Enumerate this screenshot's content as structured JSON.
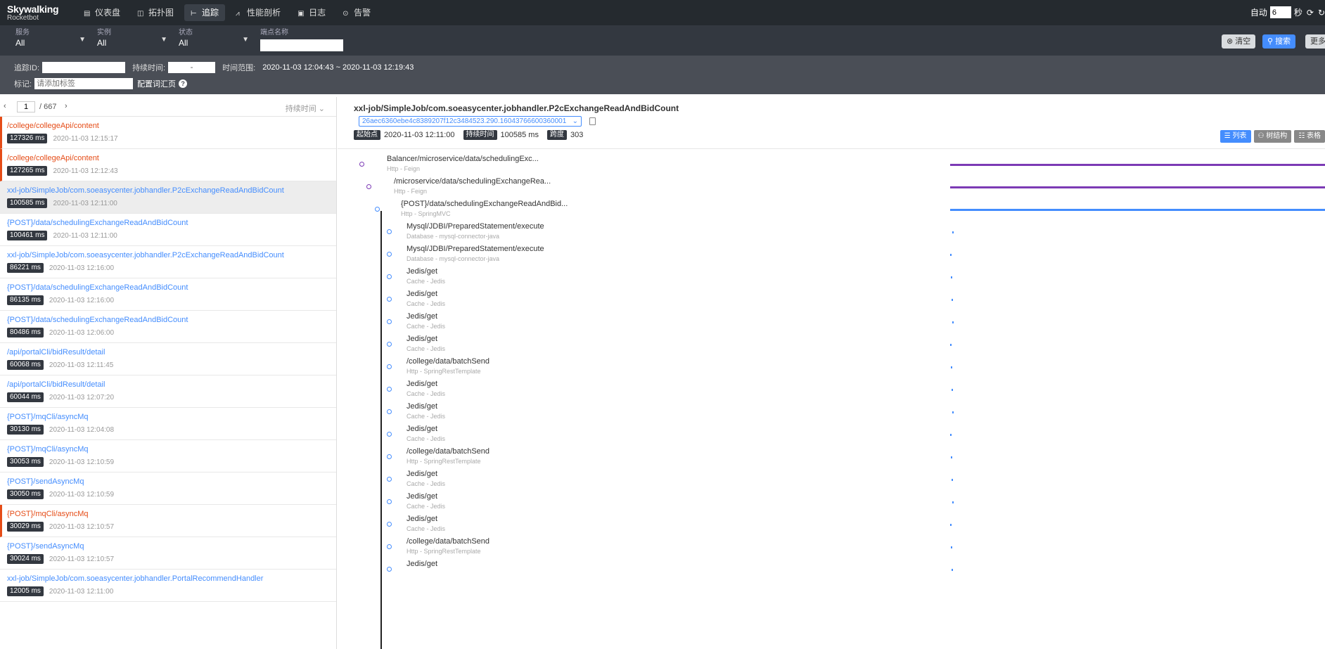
{
  "app": {
    "logo_line1": "Skywalking",
    "logo_line2": "Rocketbot"
  },
  "nav": [
    {
      "label": "仪表盘",
      "icon": "dashboard-icon",
      "glyph": "▤"
    },
    {
      "label": "拓扑图",
      "icon": "topology-icon",
      "glyph": "◫"
    },
    {
      "label": "追踪",
      "icon": "trace-icon",
      "glyph": "⊢"
    },
    {
      "label": "性能剖析",
      "icon": "profile-icon",
      "glyph": "⩘"
    },
    {
      "label": "日志",
      "icon": "log-icon",
      "glyph": "▣"
    },
    {
      "label": "告警",
      "icon": "alarm-icon",
      "glyph": "⊙"
    }
  ],
  "topright": {
    "auto_label": "自动",
    "interval": "6",
    "unit": "秒"
  },
  "filters": {
    "service": {
      "label": "服务",
      "value": "All"
    },
    "instance": {
      "label": "实例",
      "value": "All"
    },
    "status": {
      "label": "状态",
      "value": "All"
    },
    "endpoint": {
      "label": "端点名称",
      "value": ""
    },
    "clear": "清空",
    "search": "搜索",
    "more": "更多"
  },
  "filters2": {
    "trace_id_label": "追踪ID:",
    "duration_label": "持续时间:",
    "duration_sep": "-",
    "time_range_label": "时间范围:",
    "time_range_value": "2020-11-03 12:04:43 ~ 2020-11-03 12:19:43",
    "tag_label": "标记:",
    "tag_placeholder": "请添加标签",
    "config_link": "配置词汇页"
  },
  "pager": {
    "prev": "‹",
    "current": "1",
    "total": "/ 667",
    "next": "›",
    "sort": "持续时间"
  },
  "traces": [
    {
      "name": "/college/collegeApi/content",
      "duration": "127326 ms",
      "time": "2020-11-03 12:15:17",
      "error": true,
      "selected": false
    },
    {
      "name": "/college/collegeApi/content",
      "duration": "127265 ms",
      "time": "2020-11-03 12:12:43",
      "error": true,
      "selected": false
    },
    {
      "name": "xxl-job/SimpleJob/com.soeasycenter.jobhandler.P2cExchangeReadAndBidCount",
      "duration": "100585 ms",
      "time": "2020-11-03 12:11:00",
      "error": false,
      "selected": true
    },
    {
      "name": "{POST}/data/schedulingExchangeReadAndBidCount",
      "duration": "100461 ms",
      "time": "2020-11-03 12:11:00",
      "error": false,
      "selected": false
    },
    {
      "name": "xxl-job/SimpleJob/com.soeasycenter.jobhandler.P2cExchangeReadAndBidCount",
      "duration": "86221 ms",
      "time": "2020-11-03 12:16:00",
      "error": false,
      "selected": false
    },
    {
      "name": "{POST}/data/schedulingExchangeReadAndBidCount",
      "duration": "86135 ms",
      "time": "2020-11-03 12:16:00",
      "error": false,
      "selected": false
    },
    {
      "name": "{POST}/data/schedulingExchangeReadAndBidCount",
      "duration": "80486 ms",
      "time": "2020-11-03 12:06:00",
      "error": false,
      "selected": false
    },
    {
      "name": "/api/portalCli/bidResult/detail",
      "duration": "60068 ms",
      "time": "2020-11-03 12:11:45",
      "error": false,
      "selected": false
    },
    {
      "name": "/api/portalCli/bidResult/detail",
      "duration": "60044 ms",
      "time": "2020-11-03 12:07:20",
      "error": false,
      "selected": false
    },
    {
      "name": "{POST}/mqCli/asyncMq",
      "duration": "30130 ms",
      "time": "2020-11-03 12:04:08",
      "error": false,
      "selected": false
    },
    {
      "name": "{POST}/mqCli/asyncMq",
      "duration": "30053 ms",
      "time": "2020-11-03 12:10:59",
      "error": false,
      "selected": false
    },
    {
      "name": "{POST}/sendAsyncMq",
      "duration": "30050 ms",
      "time": "2020-11-03 12:10:59",
      "error": false,
      "selected": false
    },
    {
      "name": "{POST}/mqCli/asyncMq",
      "duration": "30029 ms",
      "time": "2020-11-03 12:10:57",
      "error": true,
      "selected": false
    },
    {
      "name": "{POST}/sendAsyncMq",
      "duration": "30024 ms",
      "time": "2020-11-03 12:10:57",
      "error": false,
      "selected": false
    },
    {
      "name": "xxl-job/SimpleJob/com.soeasycenter.jobhandler.PortalRecommendHandler",
      "duration": "12005 ms",
      "time": "2020-11-03 12:11:00",
      "error": false,
      "selected": false
    }
  ],
  "detail": {
    "title": "xxl-job/SimpleJob/com.soeasycenter.jobhandler.P2cExchangeReadAndBidCount",
    "trace_id": "26aec6360ebe4c8389207f12c3484523.290.16043766600360001",
    "start_label": "起始点",
    "start_value": "2020-11-03 12:11:00",
    "duration_label": "持续时间",
    "duration_value": "100585 ms",
    "spans_label": "跨度",
    "spans_value": "303",
    "view_list": "列表",
    "view_tree": "树结构",
    "view_table": "表格"
  },
  "spans": [
    {
      "name": "Balancer/microservice/data/schedulingExc...",
      "sub": "Http - Feign",
      "color": "#7c3ab5"
    },
    {
      "name": "/microservice/data/schedulingExchangeRea...",
      "sub": "Http - Feign",
      "color": "#7c3ab5"
    },
    {
      "name": "{POST}/data/schedulingExchangeReadAndBid...",
      "sub": "Http - SpringMVC",
      "color": "#448dfe"
    },
    {
      "name": "Mysql/JDBI/PreparedStatement/execute",
      "sub": "Database - mysql-connector-java",
      "color": "#448dfe"
    },
    {
      "name": "Mysql/JDBI/PreparedStatement/execute",
      "sub": "Database - mysql-connector-java",
      "color": "#448dfe"
    },
    {
      "name": "Jedis/get",
      "sub": "Cache - Jedis",
      "color": "#448dfe"
    },
    {
      "name": "Jedis/get",
      "sub": "Cache - Jedis",
      "color": "#448dfe"
    },
    {
      "name": "Jedis/get",
      "sub": "Cache - Jedis",
      "color": "#448dfe"
    },
    {
      "name": "Jedis/get",
      "sub": "Cache - Jedis",
      "color": "#448dfe"
    },
    {
      "name": "/college/data/batchSend",
      "sub": "Http - SpringRestTemplate",
      "color": "#448dfe"
    },
    {
      "name": "Jedis/get",
      "sub": "Cache - Jedis",
      "color": "#448dfe"
    },
    {
      "name": "Jedis/get",
      "sub": "Cache - Jedis",
      "color": "#448dfe"
    },
    {
      "name": "Jedis/get",
      "sub": "Cache - Jedis",
      "color": "#448dfe"
    },
    {
      "name": "/college/data/batchSend",
      "sub": "Http - SpringRestTemplate",
      "color": "#448dfe"
    },
    {
      "name": "Jedis/get",
      "sub": "Cache - Jedis",
      "color": "#448dfe"
    },
    {
      "name": "Jedis/get",
      "sub": "Cache - Jedis",
      "color": "#448dfe"
    },
    {
      "name": "Jedis/get",
      "sub": "Cache - Jedis",
      "color": "#448dfe"
    },
    {
      "name": "/college/data/batchSend",
      "sub": "Http - SpringRestTemplate",
      "color": "#448dfe"
    },
    {
      "name": "Jedis/get",
      "sub": "",
      "color": "#448dfe"
    }
  ]
}
